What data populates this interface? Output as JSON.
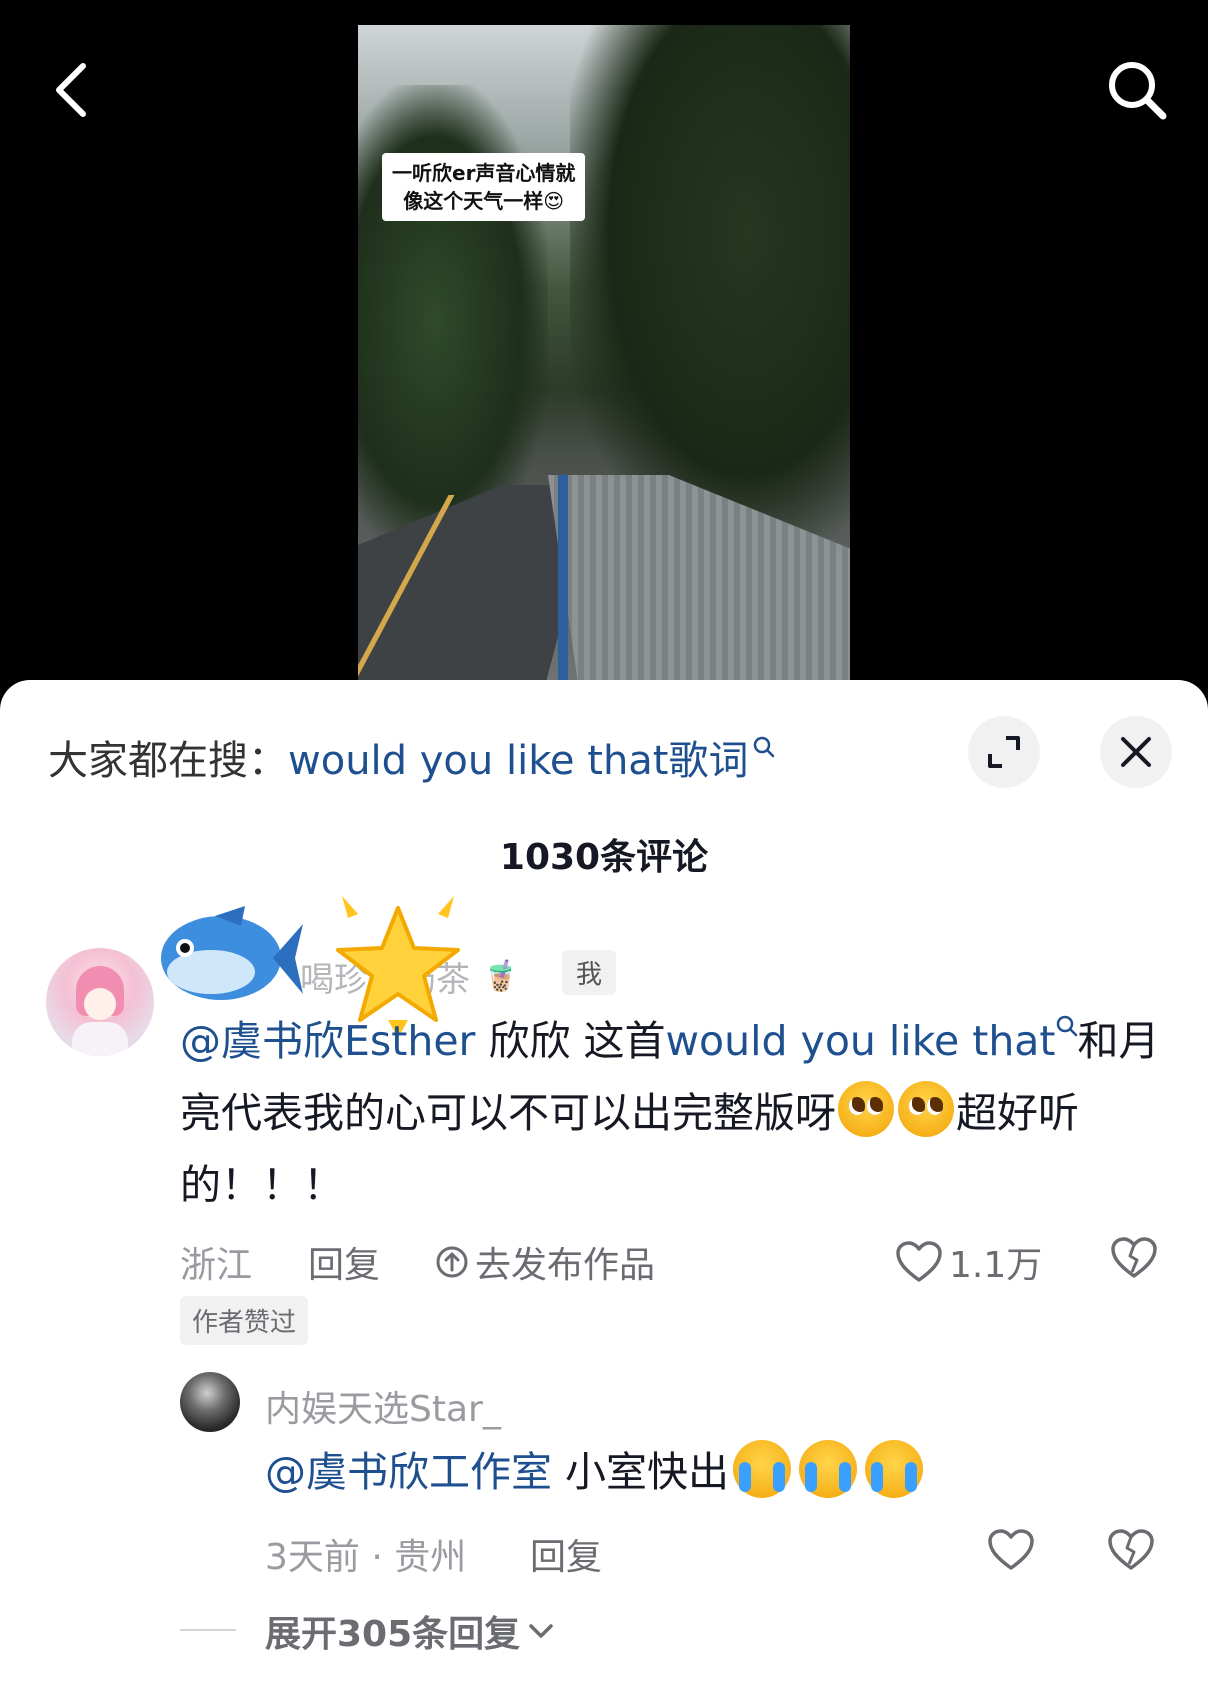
{
  "video": {
    "caption_line1": "一听欣er声音心情就",
    "caption_line2": "像这个天气一样😍"
  },
  "top_bar": {
    "back_icon": "chevron-left-icon",
    "search_icon": "search-icon"
  },
  "search_hint": {
    "label": "大家都在搜：",
    "query": "would you like that歌词"
  },
  "comments_header": {
    "count_text": "1030条评论"
  },
  "comment": {
    "username": "喝珍珠奶茶",
    "username_emoji": "🧋",
    "badge": "我",
    "mention": "@虞书欣Esther",
    "text_part1": " 欣欣 这首",
    "song_link": "would you like that",
    "text_part2": "和月亮代表我的心可以不可以出完整版呀",
    "text_part3": "超好听的！！！",
    "location": "浙江",
    "reply_label": "回复",
    "publish_label": "去发布作品",
    "likes": "1.1万",
    "author_liked": "作者赞过"
  },
  "reply": {
    "username": "内娱天选Star_",
    "mention": "@虞书欣工作室",
    "text": " 小室快出",
    "time_location": "3天前 · 贵州",
    "reply_label": "回复"
  },
  "expand": {
    "label": "展开305条回复"
  },
  "colors": {
    "link_blue": "#1e4f8e",
    "gray_text": "#9a9ba0"
  }
}
